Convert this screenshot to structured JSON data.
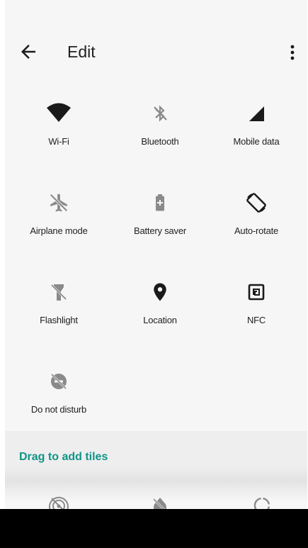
{
  "header": {
    "title": "Edit"
  },
  "tiles": [
    {
      "label": "Wi-Fi",
      "icon": "wifi-icon"
    },
    {
      "label": "Bluetooth",
      "icon": "bluetooth-off-icon"
    },
    {
      "label": "Mobile data",
      "icon": "mobile-data-icon"
    },
    {
      "label": "Airplane mode",
      "icon": "airplane-off-icon"
    },
    {
      "label": "Battery saver",
      "icon": "battery-saver-icon"
    },
    {
      "label": "Auto-rotate",
      "icon": "auto-rotate-icon"
    },
    {
      "label": "Flashlight",
      "icon": "flashlight-off-icon"
    },
    {
      "label": "Location",
      "icon": "location-icon"
    },
    {
      "label": "NFC",
      "icon": "nfc-icon"
    },
    {
      "label": "Do not disturb",
      "icon": "do-not-disturb-icon"
    }
  ],
  "drag_area": {
    "label": "Drag to add tiles",
    "tiles": [
      {
        "icon": "hotspot-off-icon"
      },
      {
        "icon": "invert-colors-off-icon"
      },
      {
        "icon": "data-saver-icon"
      }
    ]
  },
  "colors": {
    "accent": "#119488",
    "icon": "#1a1a1a",
    "icon_disabled": "#8a8a8a",
    "background": "#f6f6f6"
  }
}
